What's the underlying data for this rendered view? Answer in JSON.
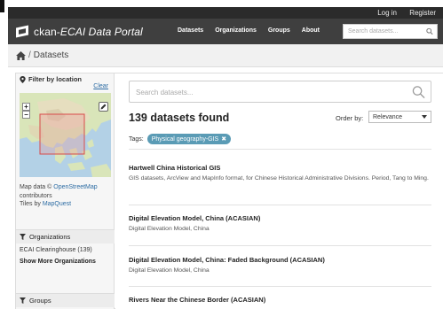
{
  "account": {
    "login": "Log in",
    "register": "Register"
  },
  "brand": {
    "prefix": "ckan-",
    "title": "ECAI Data Portal"
  },
  "nav": [
    "Datasets",
    "Organizations",
    "Groups",
    "About"
  ],
  "top_search": {
    "placeholder": "Search datasets..."
  },
  "breadcrumb": {
    "current": "Datasets"
  },
  "sidebar": {
    "filter_title": "Filter by location",
    "clear": "Clear",
    "attribution": {
      "map_data": "Map data ©",
      "osm": "OpenStreetMap",
      "contributors": "contributors",
      "tiles_by": "Tiles by",
      "mapquest": "MapQuest"
    },
    "organizations": {
      "title": "Organizations",
      "items": [
        "ECAI Clearinghouse (139)"
      ],
      "show_more": "Show More Organizations"
    },
    "groups": {
      "title": "Groups"
    }
  },
  "main": {
    "search_placeholder": "Search datasets...",
    "count_text": "139 datasets found",
    "order_by_label": "Order by:",
    "order_by_value": "Relevance",
    "tags_label": "Tags:",
    "active_tag": "Physical geography-GIS",
    "datasets": [
      {
        "title": "Hartwell China Historical GIS",
        "notes": "GIS datasets, ArcView and MapInfo format, for Chinese Historical Administrative Divisions. Period, Tang to Ming."
      },
      {
        "title": "Digital Elevation Model, China (ACASIAN)",
        "notes": "Digital Elevation Model, China"
      },
      {
        "title": "Digital Elevation Model, China: Faded Background (ACASIAN)",
        "notes": "Digital Elevation Model, China"
      },
      {
        "title": "Rivers Near the Chinese Border (ACASIAN)",
        "notes": ""
      }
    ]
  },
  "colors": {
    "masthead": "#3f3f3f",
    "account_bar": "#2b2b2b",
    "link": "#2e6da4",
    "tag": "#5a9bb5"
  }
}
